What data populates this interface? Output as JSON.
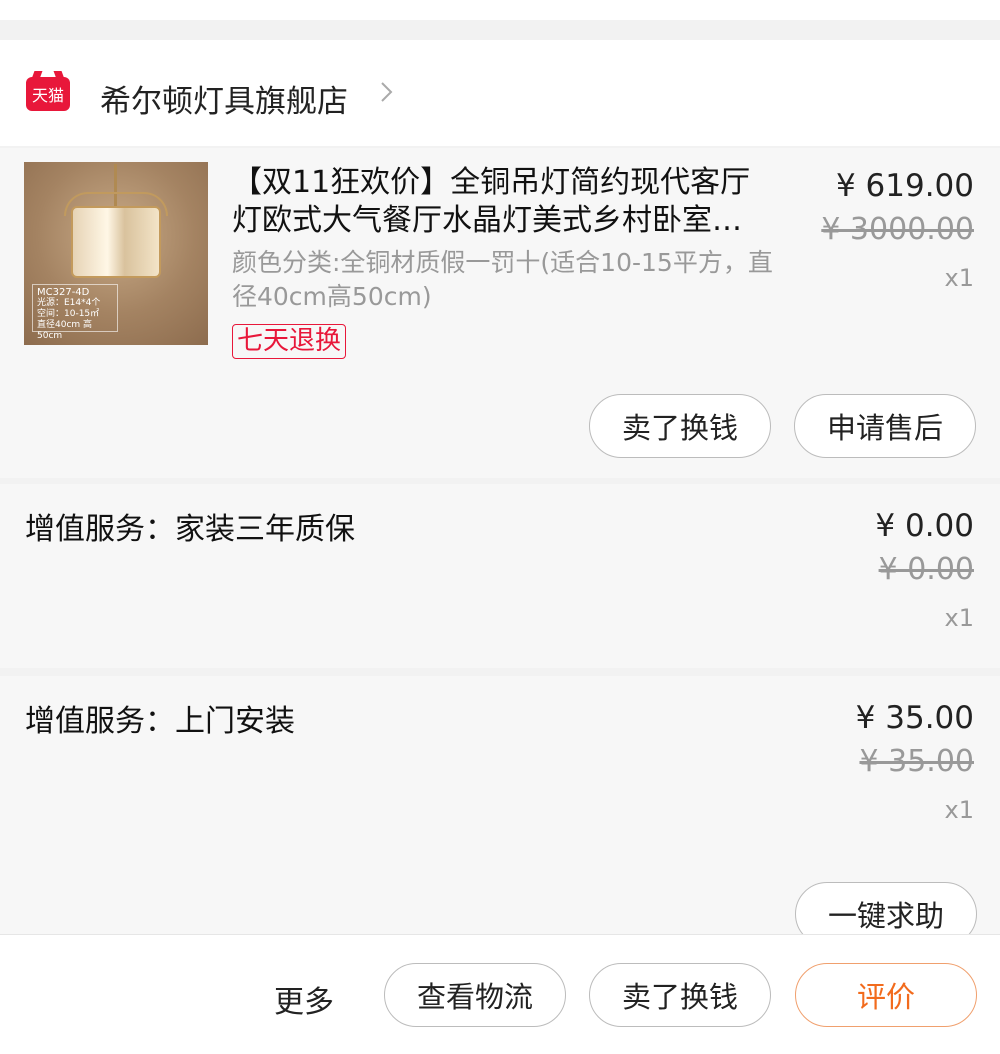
{
  "store": {
    "logo_text": "天猫",
    "name": "希尔顿灯具旗舰店"
  },
  "product": {
    "title_line1": "【双11狂欢价】全铜吊灯简约现代客厅",
    "title_line2": "灯欧式大气餐厅水晶灯美式乡村卧室…",
    "spec": "颜色分类:全铜材质假一罚十(适合10-15平方，直径40cm高50cm)",
    "badge": "七天退换",
    "image_model": "MC327-4D",
    "image_line1": "光源：E14*4个",
    "image_line2": "空间：10-15㎡",
    "image_line3": "直径40cm 高50cm",
    "price": "¥ 619.00",
    "original_price": "¥ 3000.00",
    "quantity": "x1",
    "btn_sell": "卖了换钱",
    "btn_after_sale": "申请售后"
  },
  "services": [
    {
      "label": "增值服务：家装三年质保",
      "price": "¥ 0.00",
      "original_price": "¥ 0.00",
      "quantity": "x1"
    },
    {
      "label": "增值服务：上门安装",
      "price": "¥ 35.00",
      "original_price": "¥ 35.00",
      "quantity": "x1",
      "btn_help": "一键求助"
    }
  ],
  "bottom": {
    "more": "更多",
    "btn_logistics": "查看物流",
    "btn_sell": "卖了换钱",
    "btn_review": "评价"
  },
  "colors": {
    "accent_red": "#e8173a",
    "accent_orange": "#f26b1d"
  }
}
